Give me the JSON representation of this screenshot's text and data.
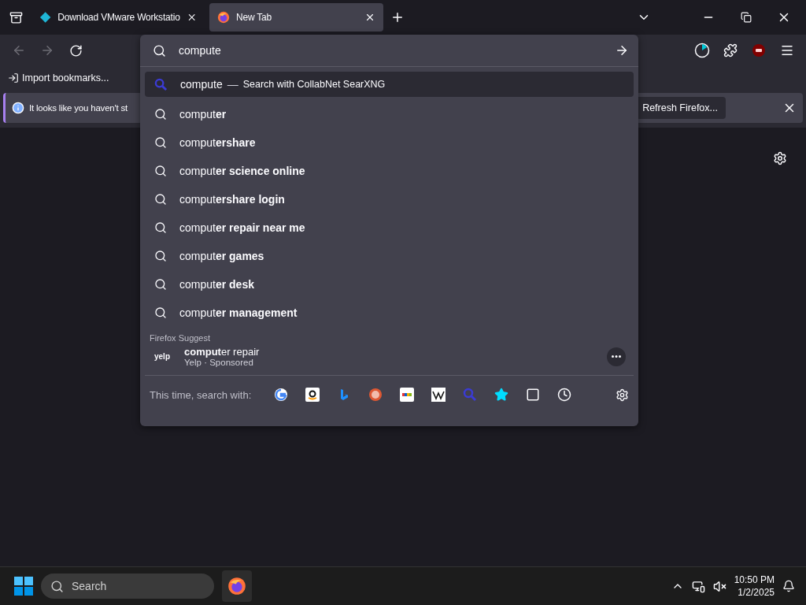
{
  "tabs": [
    {
      "label": "Download VMware Workstatio",
      "selected": false
    },
    {
      "label": "New Tab",
      "selected": true
    }
  ],
  "address_bar": {
    "value": "compute"
  },
  "bookmarks_bar": {
    "items": [
      "Import bookmarks..."
    ]
  },
  "notification": {
    "text": "It looks like you haven't st",
    "button": "Refresh Firefox..."
  },
  "suggestions": {
    "heading_row": {
      "query": "compute",
      "separator": "—",
      "action": "Search with CollabNet SearXNG",
      "selected": true
    },
    "items": [
      {
        "text": "comput**er**",
        "selected": false
      },
      {
        "text": "comput**ershare**",
        "selected": false
      },
      {
        "text": "comput**er science online**",
        "selected": false
      },
      {
        "text": "comput**ershare login**",
        "selected": false
      },
      {
        "text": "comput**er repair near me**",
        "selected": false
      },
      {
        "text": "comput**er games**",
        "selected": false
      },
      {
        "text": "comput**er desk**",
        "selected": false
      },
      {
        "text": "comput**er management**",
        "selected": false
      }
    ],
    "group_label": "Firefox Suggest",
    "sponsored": {
      "logo": "yelp",
      "title": "**comput**er repair",
      "subtitle": "Yelp · Sponsored"
    },
    "search_with_label": "This time, search with:"
  },
  "taskbar": {
    "search_placeholder": "Search",
    "time": "10:50 PM",
    "date": "1/2/2025"
  }
}
